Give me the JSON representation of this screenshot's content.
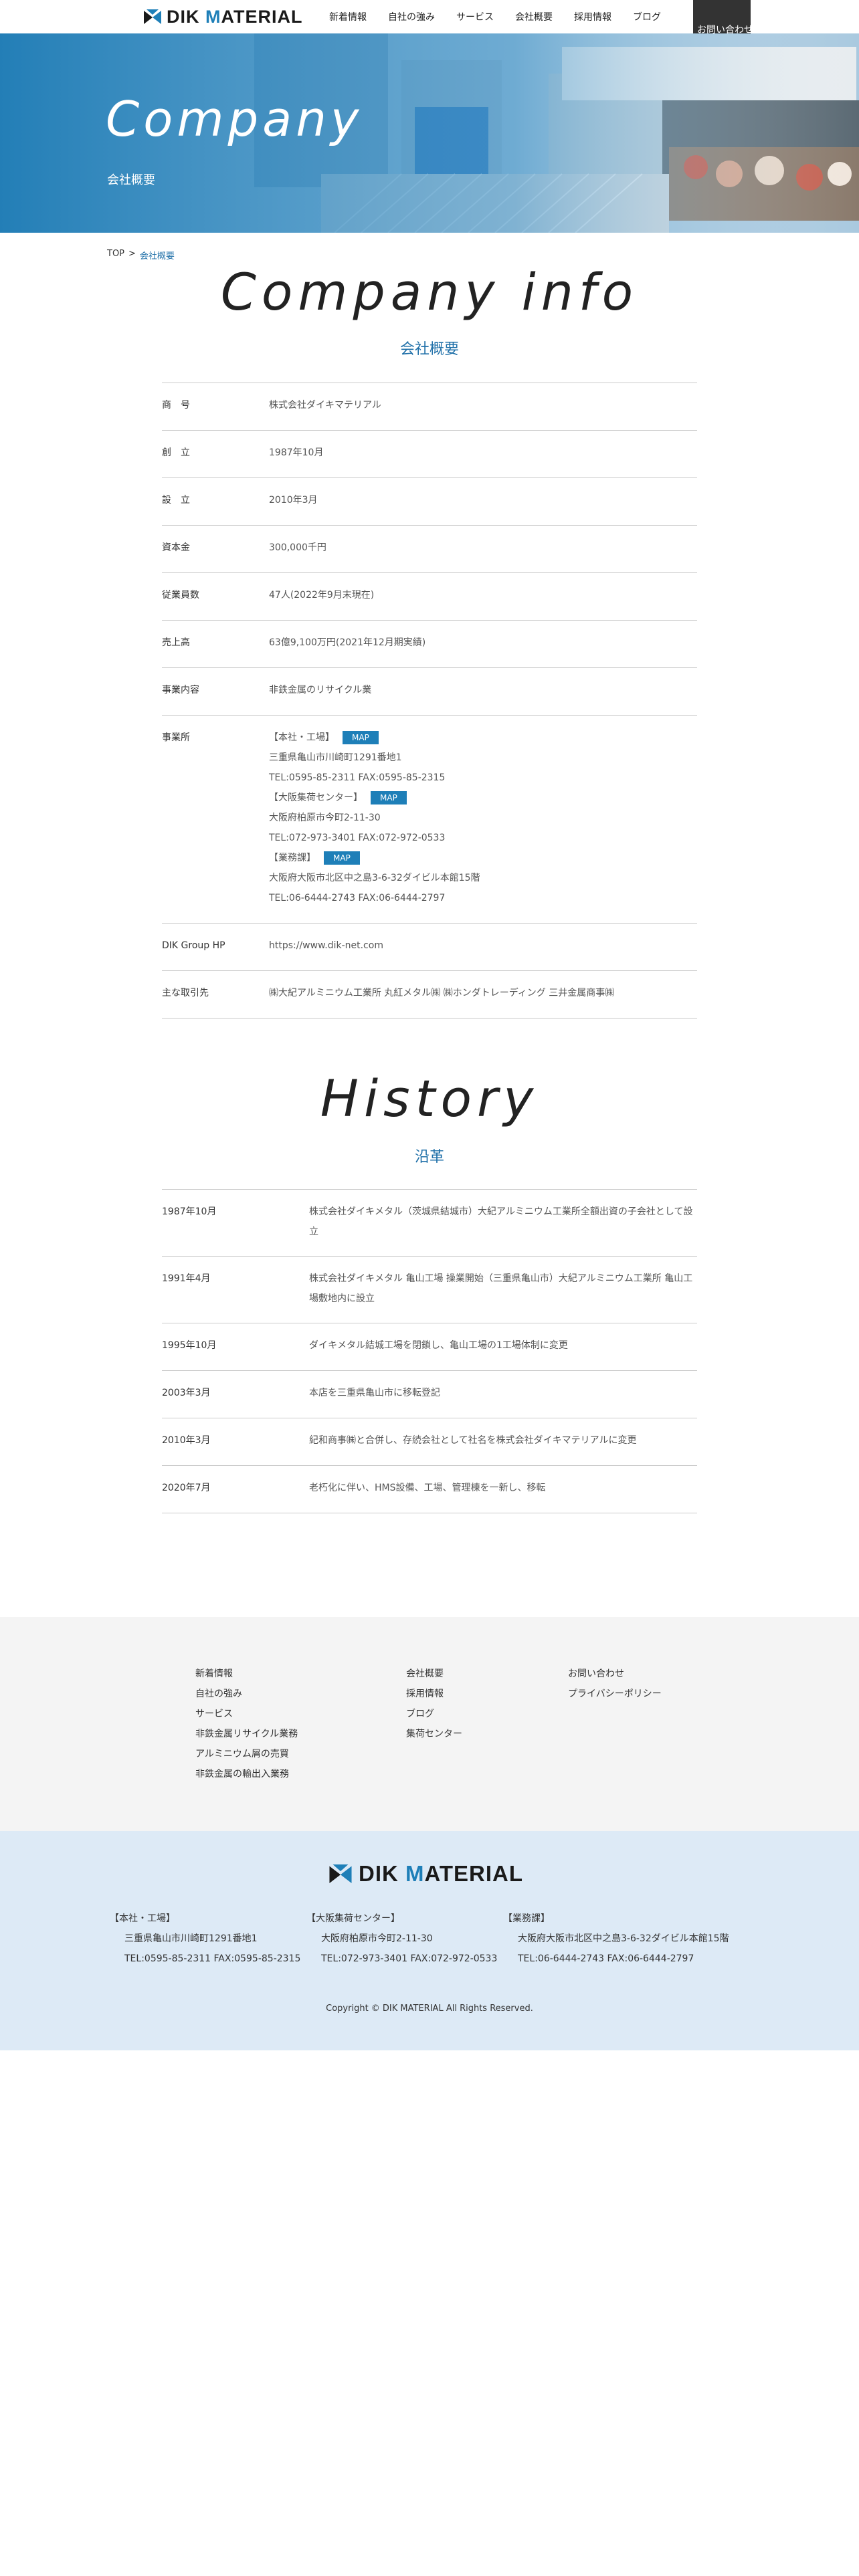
{
  "header": {
    "logo_text_prefix": "DIK ",
    "logo_text_accent": "M",
    "logo_text_suffix": "ATERIAL",
    "nav": [
      "新着情報",
      "自社の強み",
      "サービス",
      "会社概要",
      "採用情報",
      "ブログ"
    ],
    "contact_label": "お問い合わせ"
  },
  "hero": {
    "title": "Company",
    "subtitle": "会社概要"
  },
  "breadcrumb": {
    "top": "TOP",
    "separator": ">",
    "current": "会社概要"
  },
  "company": {
    "title_en": "Company info",
    "title_ja": "会社概要",
    "rows": [
      {
        "label": "商　号",
        "value": "株式会社ダイキマテリアル"
      },
      {
        "label": "創　立",
        "value": "1987年10月"
      },
      {
        "label": "設　立",
        "value": "2010年3月"
      },
      {
        "label": "資本金",
        "value": "300,000千円"
      },
      {
        "label": "従業員数",
        "value": "47人(2022年9月末現在)"
      },
      {
        "label": "売上高",
        "value": "63億9,100万円(2021年12月期実績)"
      },
      {
        "label": "事業内容",
        "value": "非鉄金属のリサイクル業"
      }
    ],
    "offices_label": "事業所",
    "offices": [
      {
        "name": "【本社・工場】",
        "map": "MAP",
        "address": "三重県亀山市川崎町1291番地1",
        "tel": "TEL:0595-85-2311 FAX:0595-85-2315"
      },
      {
        "name": "【大阪集荷センター】",
        "map": "MAP",
        "address": "大阪府柏原市今町2-11-30",
        "tel": "TEL:072-973-3401 FAX:072-972-0533"
      },
      {
        "name": "【業務課】",
        "map": "MAP",
        "address": "大阪府大阪市北区中之島3-6-32ダイビル本館15階",
        "tel": "TEL:06-6444-2743 FAX:06-6444-2797"
      }
    ],
    "group_label": "DIK Group HP",
    "group_value": "https://www.dik-net.com",
    "clients_label": "主な取引先",
    "clients_value": "㈱大紀アルミニウム工業所 丸紅メタル㈱ ㈱ホンダトレーディング 三井金属商事㈱"
  },
  "history": {
    "title_en": "History",
    "title_ja": "沿革",
    "rows": [
      {
        "date": "1987年10月",
        "text": "株式会社ダイキメタル（茨城県結城市）大紀アルミニウム工業所全額出資の子会社として設立"
      },
      {
        "date": "1991年4月",
        "text": "株式会社ダイキメタル 亀山工場 操業開始（三重県亀山市）大紀アルミニウム工業所 亀山工場敷地内に設立"
      },
      {
        "date": "1995年10月",
        "text": "ダイキメタル結城工場を閉鎖し、亀山工場の1工場体制に変更"
      },
      {
        "date": "2003年3月",
        "text": "本店を三重県亀山市に移転登記"
      },
      {
        "date": "2010年3月",
        "text": "紀和商事㈱と合併し、存続会社として社名を株式会社ダイキマテリアルに変更"
      },
      {
        "date": "2020年7月",
        "text": "老朽化に伴い、HMS設備、工場、管理棟を一新し、移転"
      }
    ]
  },
  "footer_nav": {
    "col1": [
      "新着情報",
      "自社の強み",
      "サービス",
      "非鉄金属リサイクル業務",
      "アルミニウム屑の売買",
      "非鉄金属の輸出入業務"
    ],
    "col2": [
      "会社概要",
      "採用情報",
      "ブログ",
      "集荷センター"
    ],
    "col3": [
      "お問い合わせ",
      "プライバシーポリシー"
    ]
  },
  "footer_info": {
    "offices": [
      {
        "name": "【本社・工場】",
        "address": "三重県亀山市川崎町1291番地1",
        "tel": "TEL:0595-85-2311 FAX:0595-85-2315"
      },
      {
        "name": "【大阪集荷センター】",
        "address": "大阪府柏原市今町2-11-30",
        "tel": "TEL:072-973-3401 FAX:072-972-0533"
      },
      {
        "name": "【業務課】",
        "address": "大阪府大阪市北区中之島3-6-32ダイビル本館15階",
        "tel": "TEL:06-6444-2743 FAX:06-6444-2797"
      }
    ],
    "copyright": "Copyright © DIK MATERIAL All Rights Reserved."
  },
  "colors": {
    "accent": "#1e7fb8",
    "heading_ja": "#1e6fa8",
    "footer_nav_bg": "#f4f4f4",
    "footer_info_bg": "#ddeaf6",
    "contact_bg": "#333333"
  },
  "icons": [
    "logo-mark-icon"
  ]
}
